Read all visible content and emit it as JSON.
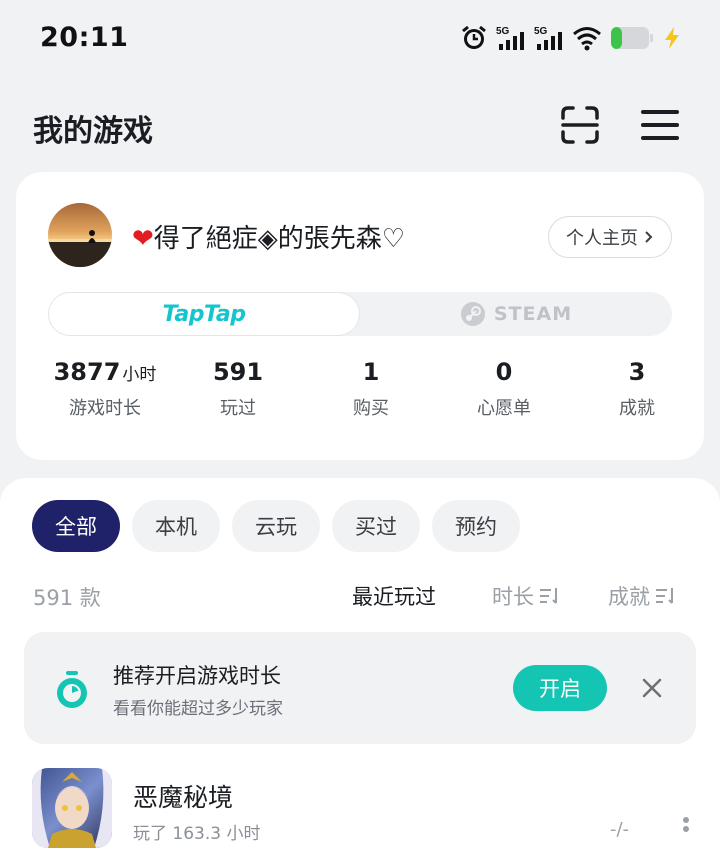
{
  "status_bar": {
    "time": "20:11",
    "icons": [
      "alarm-icon",
      "signal-5g-icon",
      "signal-5g-icon",
      "wifi-icon",
      "battery-icon",
      "charging-icon"
    ],
    "network_label_1": "5G",
    "network_label_2": "5G"
  },
  "header": {
    "title": "我的游戏",
    "scan_icon": "scan-icon",
    "menu_icon": "menu-icon"
  },
  "profile": {
    "username": "得了絕症◈的張先森♡",
    "heart": "❤",
    "home_button": "个人主页",
    "platforms": [
      "TapTap",
      "STEAM"
    ],
    "selected_platform": "TapTap",
    "stats": [
      {
        "value": "3877",
        "unit": "小时",
        "label": "游戏时长"
      },
      {
        "value": "591",
        "unit": "",
        "label": "玩过"
      },
      {
        "value": "1",
        "unit": "",
        "label": "购买"
      },
      {
        "value": "0",
        "unit": "",
        "label": "心愿单"
      },
      {
        "value": "3",
        "unit": "",
        "label": "成就"
      }
    ]
  },
  "filters": {
    "chips": [
      "全部",
      "本机",
      "云玩",
      "买过",
      "预约"
    ],
    "active": "全部"
  },
  "sort": {
    "count": "591 款",
    "recent": "最近玩过",
    "duration": "时长",
    "achievement": "成就"
  },
  "promo": {
    "title": "推荐开启游戏时长",
    "subtitle": "看看你能超过多少玩家",
    "button": "开启"
  },
  "games": [
    {
      "name": "恶魔秘境",
      "played": "玩了 163.3 小时",
      "score": "-/-"
    }
  ],
  "colors": {
    "accent_teal": "#15c5b3",
    "active_chip": "#1f2169",
    "background": "#f1f2f4"
  }
}
